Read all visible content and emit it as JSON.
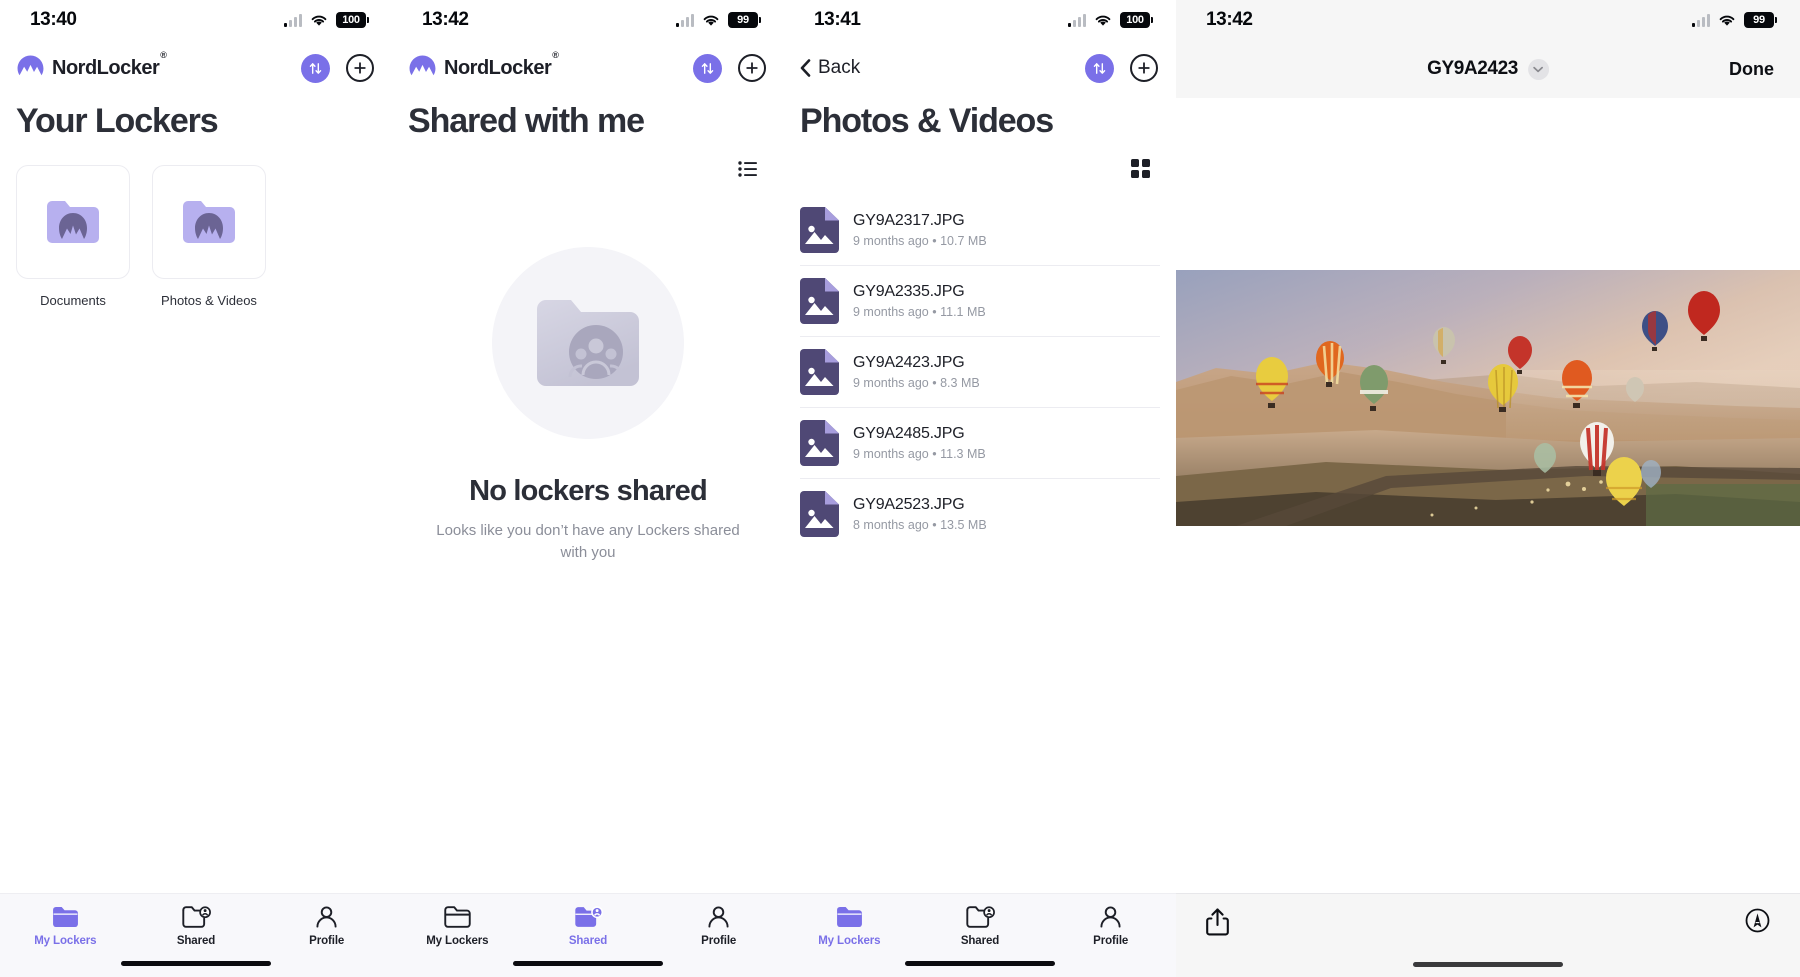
{
  "panels": [
    {
      "id": "your-lockers",
      "status": {
        "time": "13:40",
        "battery": "100"
      },
      "brand": "NordLocker",
      "title": "Your Lockers",
      "actions": [
        "sync-icon",
        "plus-icon"
      ],
      "lockers": [
        {
          "label": "Documents"
        },
        {
          "label": "Photos & Videos"
        }
      ],
      "tabs": [
        {
          "label": "My Lockers",
          "icon": "folder-filled-icon",
          "active": true
        },
        {
          "label": "Shared",
          "icon": "folder-person-icon",
          "active": false
        },
        {
          "label": "Profile",
          "icon": "person-icon",
          "active": false
        }
      ]
    },
    {
      "id": "shared-with-me",
      "status": {
        "time": "13:42",
        "battery": "99"
      },
      "brand": "NordLocker",
      "title": "Shared with me",
      "actions": [
        "sync-icon",
        "plus-icon"
      ],
      "view_toggle": "list-view-icon",
      "empty": {
        "icon": "folder-people-icon",
        "title": "No lockers shared",
        "subtitle": "Looks like you don’t have any Lockers shared with you"
      },
      "tabs": [
        {
          "label": "My Lockers",
          "icon": "folder-outline-icon",
          "active": false
        },
        {
          "label": "Shared",
          "icon": "folder-person-icon",
          "active": true
        },
        {
          "label": "Profile",
          "icon": "person-icon",
          "active": false
        }
      ]
    },
    {
      "id": "photos-and-videos",
      "status": {
        "time": "13:41",
        "battery": "100"
      },
      "back_label": "Back",
      "title": "Photos & Videos",
      "actions": [
        "sync-icon",
        "plus-icon"
      ],
      "view_toggle": "grid-view-icon",
      "files": [
        {
          "name": "GY9A2317.JPG",
          "age": "9 months ago",
          "size": "10.7 MB"
        },
        {
          "name": "GY9A2335.JPG",
          "age": "9 months ago",
          "size": "11.1 MB"
        },
        {
          "name": "GY9A2423.JPG",
          "age": "9 months ago",
          "size": "8.3 MB"
        },
        {
          "name": "GY9A2485.JPG",
          "age": "9 months ago",
          "size": "11.3 MB"
        },
        {
          "name": "GY9A2523.JPG",
          "age": "8 months ago",
          "size": "13.5 MB"
        }
      ],
      "separator": "•",
      "tabs": [
        {
          "label": "My Lockers",
          "icon": "folder-filled-icon",
          "active": true
        },
        {
          "label": "Shared",
          "icon": "folder-person-icon",
          "active": false
        },
        {
          "label": "Profile",
          "icon": "person-icon",
          "active": false
        }
      ]
    },
    {
      "id": "photo-viewer",
      "status": {
        "time": "13:42",
        "battery": "99"
      },
      "title": "GY9A2423",
      "chevron": "chevron-down-icon",
      "done_label": "Done",
      "photo_alt": "Hot air balloons over desert valley at dawn",
      "toolbar": [
        "share-icon",
        "markup-icon"
      ]
    }
  ],
  "colors": {
    "accent": "#7a70e8",
    "folder_light": "#b7b0ef",
    "folder_dark": "#5b5480",
    "file_icon": "#4f4875",
    "text": "#1d1f27",
    "muted": "#9599a3"
  }
}
